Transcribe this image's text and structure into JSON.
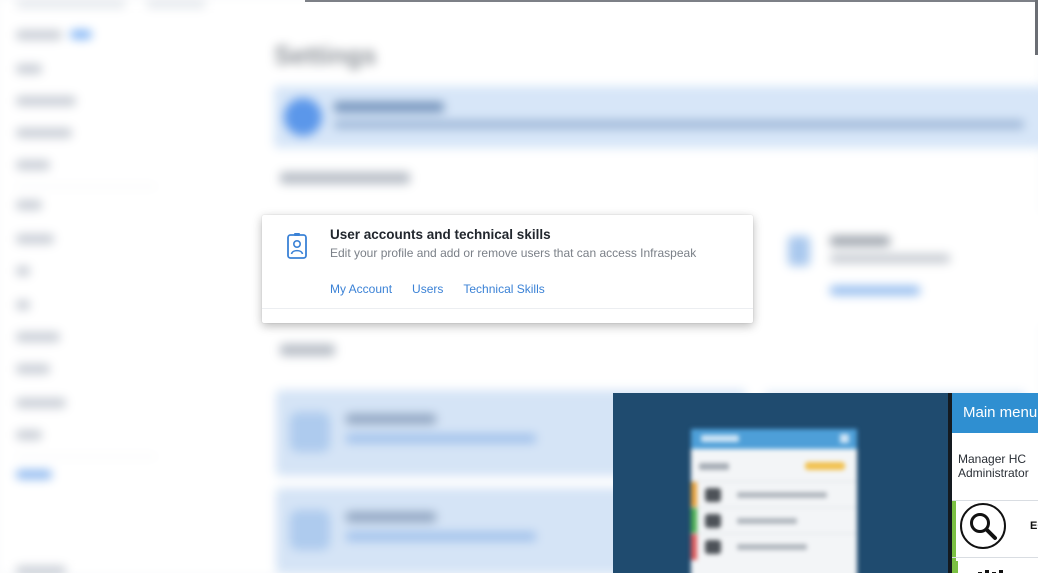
{
  "background": {
    "page_title": "Settings"
  },
  "card": {
    "title": "User accounts and technical skills",
    "description": "Edit your profile and add or remove users that can access Infraspeak",
    "links": {
      "my_account": "My Account",
      "users": "Users",
      "technical_skills": "Technical Skills"
    },
    "icon": "id-badge-icon",
    "accent_color": "#3b82d6"
  },
  "video_inset": {
    "menu_title": "Main menu",
    "user_name": "Manager HC",
    "user_role": "Administrator",
    "item_label": "EC",
    "search_icon": "search-icon",
    "header_color": "#2f8fd1"
  }
}
